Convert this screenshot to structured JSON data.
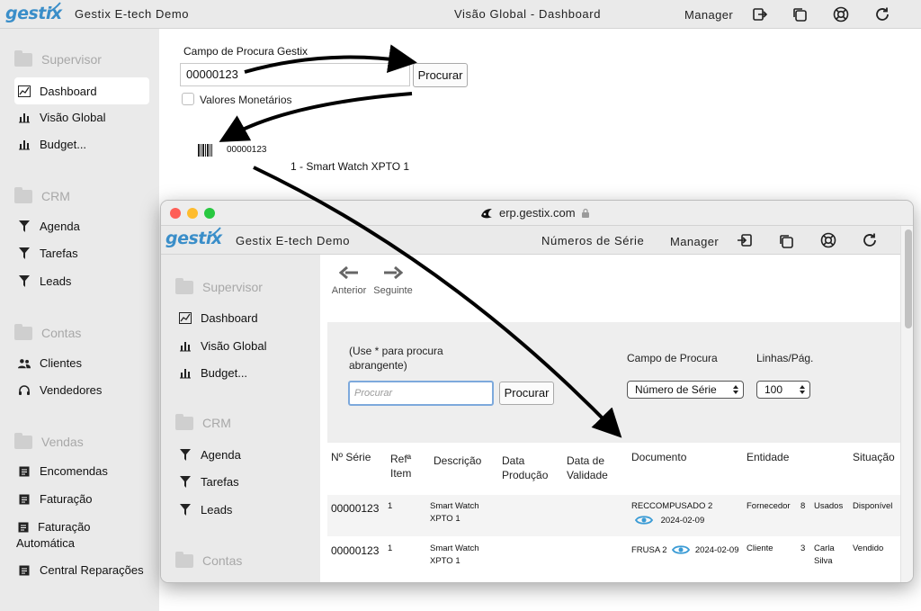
{
  "app": {
    "logo": "gestix",
    "company": "Gestix E-tech Demo",
    "title": "Visão Global - Dashboard",
    "user": "Manager"
  },
  "sidebar": {
    "groups": [
      {
        "header": "Supervisor",
        "items": [
          "Dashboard",
          "Visão Global",
          "Budget..."
        ]
      },
      {
        "header": "CRM",
        "items": [
          "Agenda",
          "Tarefas",
          "Leads"
        ]
      },
      {
        "header": "Contas",
        "items": [
          "Clientes",
          "Vendedores"
        ]
      },
      {
        "header": "Vendas",
        "items": [
          "Encomendas",
          "Faturação",
          "Faturação Automática",
          "Central Reparações"
        ]
      }
    ]
  },
  "search": {
    "label": "Campo de Procura Gestix",
    "value": "00000123",
    "button": "Procurar",
    "checkbox_label": "Valores Monetários"
  },
  "result": {
    "code": "00000123",
    "name": "1 - Smart Watch XPTO 1"
  },
  "window": {
    "url": "erp.gestix.com",
    "logo": "gestix",
    "company": "Gestix E-tech Demo",
    "title": "Números de Série",
    "user": "Manager",
    "sidebar": {
      "groups": [
        {
          "header": "Supervisor",
          "items": [
            "Dashboard",
            "Visão Global",
            "Budget..."
          ]
        },
        {
          "header": "CRM",
          "items": [
            "Agenda",
            "Tarefas",
            "Leads"
          ]
        },
        {
          "header": "Contas",
          "items": []
        }
      ]
    },
    "nav": {
      "prev": "Anterior",
      "next": "Seguinte"
    },
    "filter": {
      "hint": "(Use * para procura abrangente)",
      "placeholder": "Procurar",
      "button": "Procurar",
      "field_label": "Campo de Procura",
      "field_value": "Número de Série",
      "rows_label": "Linhas/Pág.",
      "rows_value": "100"
    },
    "table": {
      "headers": [
        "Nº Série",
        "Refª Item",
        "Descrição",
        "Data Produção",
        "Data de Validade",
        "Documento",
        "Entidade",
        "Situação"
      ],
      "rows": [
        {
          "serial": "00000123",
          "ref": "1",
          "desc": "Smart Watch XPTO 1",
          "doc": "RECCOMPUSADO 2",
          "doc_date": "2024-02-09",
          "entity": "Fornecedor",
          "entity_num": "8",
          "entity_name": "Usados",
          "status": "Disponível"
        },
        {
          "serial": "00000123",
          "ref": "1",
          "desc": "Smart Watch XPTO 1",
          "doc": "FRUSA 2",
          "doc_date": "2024-02-09",
          "entity": "Cliente",
          "entity_num": "3",
          "entity_name": "Carla Silva",
          "status": "Vendido"
        }
      ]
    }
  },
  "colors": {
    "brand": "#3a8ec9",
    "sidebar_bg": "#eaeaea",
    "eye": "#3a9bd5",
    "focus": "#7da9dc"
  }
}
